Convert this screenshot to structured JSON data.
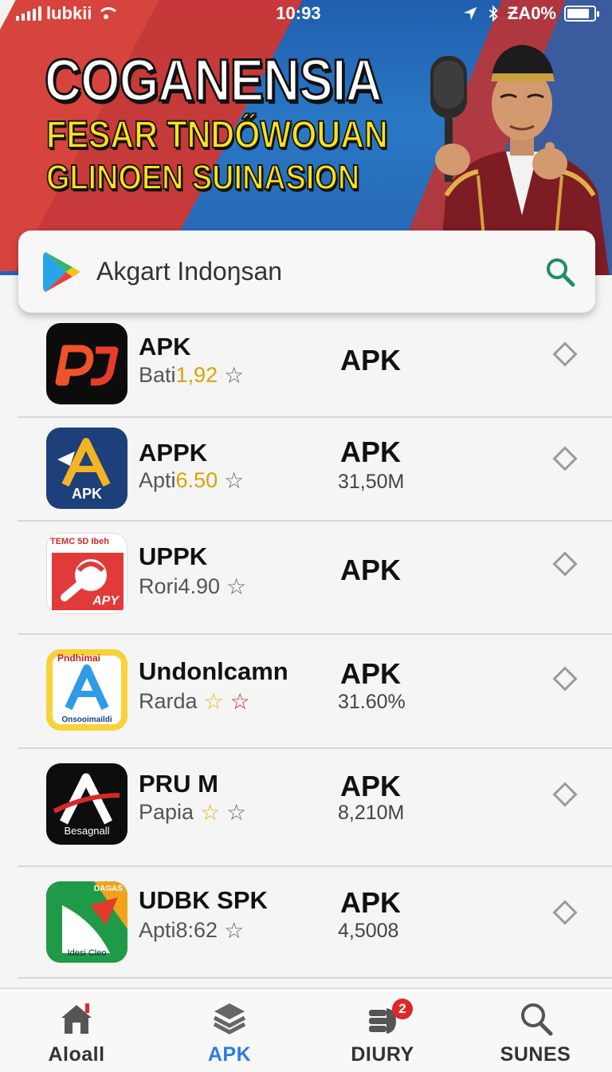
{
  "status_bar": {
    "carrier": "lubkii",
    "time": "10:93",
    "battery_text": "ƵA0%",
    "battery_level": 0.85
  },
  "hero": {
    "title": "COGANENSIA",
    "subtitle_line1": "FESAR TNDŐWOUAN",
    "subtitle_line2": "GLINOEN SUINASION"
  },
  "search": {
    "text": "Akgart Indoŋsan"
  },
  "apps": [
    {
      "name": "APK",
      "meta_prefix": "Bati",
      "meta_highlight": "1,92",
      "stars": [
        "gray"
      ],
      "label": "APK",
      "size": ""
    },
    {
      "name": "APPK",
      "meta_prefix": "Apti",
      "meta_highlight": "6.50",
      "stars": [
        "gray"
      ],
      "label": "APK",
      "size": "31,50M",
      "icon_text": "APK"
    },
    {
      "name": "UPPK",
      "meta_prefix": "Rori4.90",
      "meta_highlight": "",
      "stars": [
        "gray"
      ],
      "label": "APK",
      "size": "",
      "icon_text": "APY",
      "icon_top": "ТЕМС 5D Ibeh"
    },
    {
      "name": "Undonlcamn",
      "meta_prefix": "Rarda",
      "meta_highlight": "",
      "stars": [
        "yellow",
        "red"
      ],
      "label": "APK",
      "size": "31.60%",
      "icon_text": "Onsooimaildi",
      "icon_top": "Pndhimai"
    },
    {
      "name": "PRU M",
      "meta_prefix": "Papia",
      "meta_highlight": "",
      "stars": [
        "yellow",
        "gray"
      ],
      "label": "APK",
      "size": "8,210M",
      "icon_text": "Besagnall"
    },
    {
      "name": "UDBK SPK",
      "meta_prefix": "Apti8:62",
      "meta_highlight": "",
      "stars": [
        "gray"
      ],
      "label": "APK",
      "size": "4,5008",
      "icon_text": "Idesi Cleo",
      "icon_top": "DAGAS"
    }
  ],
  "nav": [
    {
      "label": "Aloall",
      "icon": "home-icon",
      "active": false
    },
    {
      "label": "APK",
      "icon": "stack-icon",
      "active": true
    },
    {
      "label": "DIURY",
      "icon": "hand-icon",
      "active": false,
      "badge": "2"
    },
    {
      "label": "SUNES",
      "icon": "search-icon",
      "active": false
    }
  ],
  "colors": {
    "accent": "#2a7de0",
    "search_icon": "#1f8f5f",
    "badge": "#e0262b",
    "highlight": "#d9a400"
  }
}
